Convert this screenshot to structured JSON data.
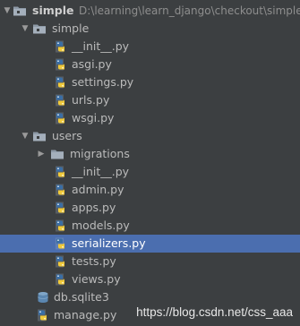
{
  "project": {
    "name": "simple",
    "path": "D:\\learning\\learn_django\\checkout\\simple"
  },
  "items": [
    {
      "label": "simple",
      "type": "folder",
      "expanded": true
    },
    {
      "label": "__init__.py",
      "type": "python-file"
    },
    {
      "label": "asgi.py",
      "type": "python-file"
    },
    {
      "label": "settings.py",
      "type": "python-file"
    },
    {
      "label": "urls.py",
      "type": "python-file"
    },
    {
      "label": "wsgi.py",
      "type": "python-file"
    },
    {
      "label": "users",
      "type": "folder",
      "expanded": true
    },
    {
      "label": "migrations",
      "type": "folder",
      "expanded": false
    },
    {
      "label": "__init__.py",
      "type": "python-file"
    },
    {
      "label": "admin.py",
      "type": "python-file"
    },
    {
      "label": "apps.py",
      "type": "python-file"
    },
    {
      "label": "models.py",
      "type": "python-file"
    },
    {
      "label": "serializers.py",
      "type": "python-file",
      "selected": true
    },
    {
      "label": "tests.py",
      "type": "python-file"
    },
    {
      "label": "views.py",
      "type": "python-file"
    },
    {
      "label": "db.sqlite3",
      "type": "database-file"
    },
    {
      "label": "manage.py",
      "type": "python-file"
    }
  ],
  "watermark": "https://blog.csdn.net/css_aaa",
  "colors": {
    "background": "#3c3f41",
    "selection": "#4b6eaf",
    "folder": "#8e9aa7",
    "python_blue": "#3a6ea5",
    "python_yellow": "#f0c93a"
  }
}
